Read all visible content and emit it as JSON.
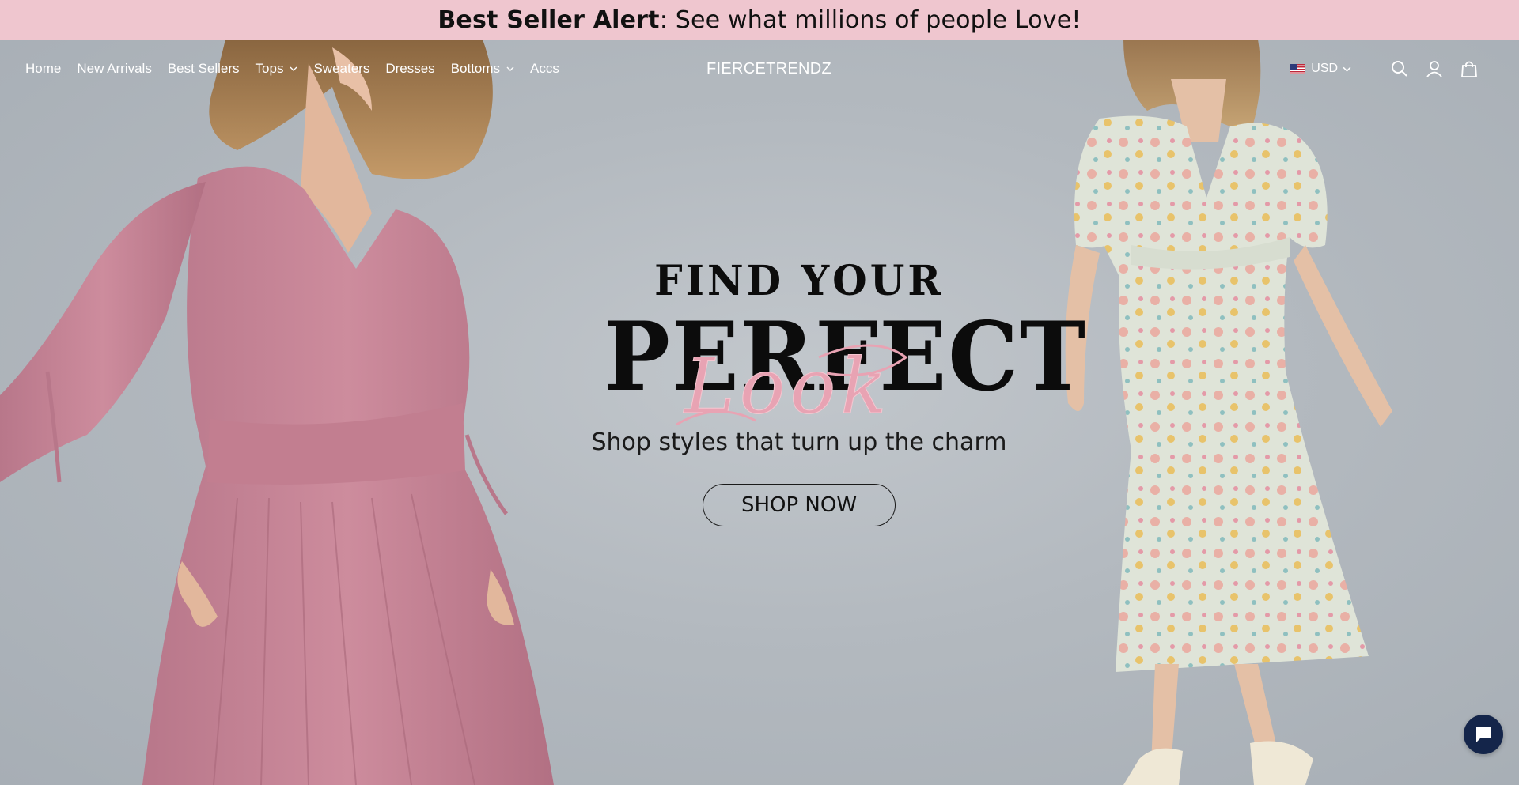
{
  "announcement": {
    "bold_text": "Best Seller Alert",
    "rest_text": ": See what millions of people Love!"
  },
  "nav": {
    "items": [
      {
        "label": "Home",
        "has_dropdown": false
      },
      {
        "label": "New Arrivals",
        "has_dropdown": false
      },
      {
        "label": "Best Sellers",
        "has_dropdown": false
      },
      {
        "label": "Tops",
        "has_dropdown": true
      },
      {
        "label": "Sweaters",
        "has_dropdown": false
      },
      {
        "label": "Dresses",
        "has_dropdown": false
      },
      {
        "label": "Bottoms",
        "has_dropdown": true
      },
      {
        "label": "Accs",
        "has_dropdown": false
      }
    ]
  },
  "brand": {
    "logo_text": "FIERCETRENDZ"
  },
  "header_right": {
    "currency": "USD",
    "icons": [
      "search-icon",
      "account-icon",
      "cart-icon"
    ]
  },
  "hero": {
    "line1": "FIND YOUR",
    "line2": "PERFECT",
    "script_word": "Look",
    "subtitle": "Shop styles that turn up the charm",
    "cta_label": "SHOP NOW"
  },
  "colors": {
    "announcement_bg": "#efc6cf",
    "hero_bg": "#b4bac0",
    "script_pink": "#e8a3b3",
    "chat_bg": "#14254a",
    "dress_left": "#c98597"
  }
}
